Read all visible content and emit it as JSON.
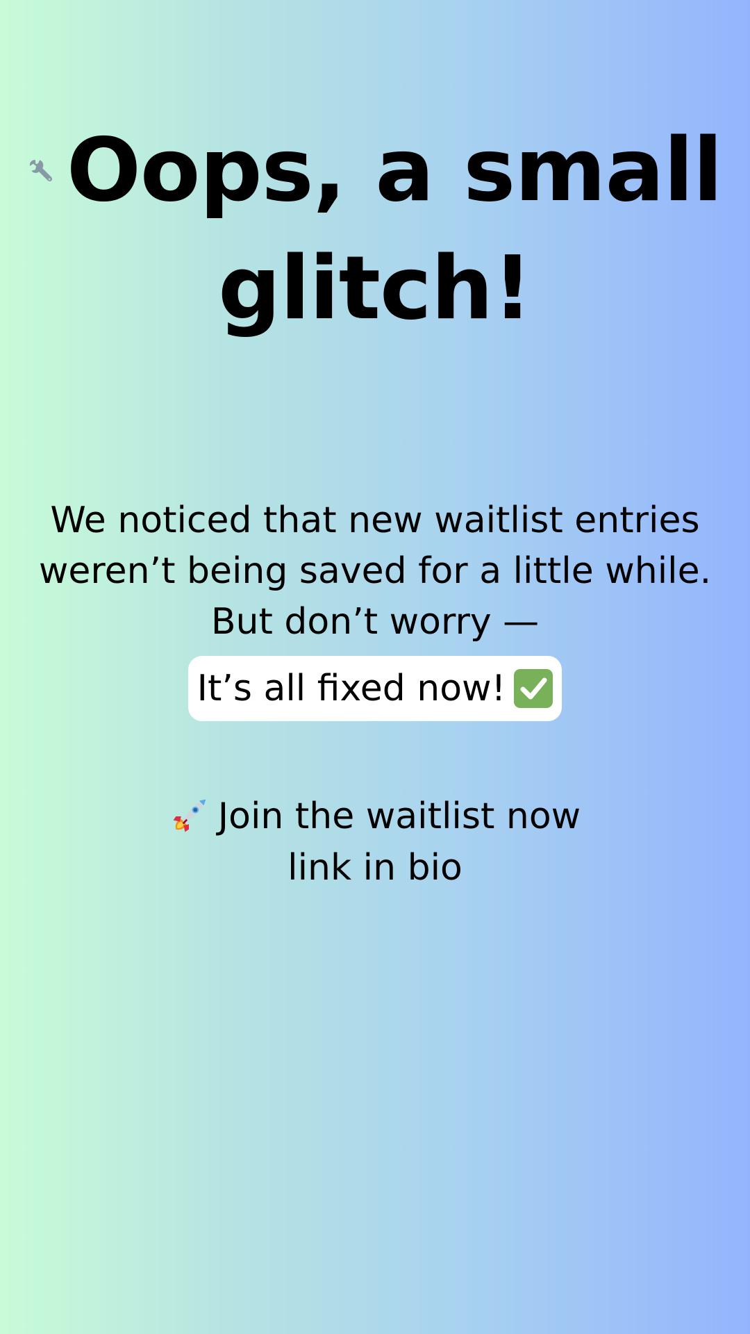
{
  "headline": {
    "line1": "Oops, a small",
    "line2": "glitch!",
    "icon": "wrench-icon"
  },
  "message": {
    "line1": "We noticed that new waitlist entries",
    "line2": "weren’t being saved for a little while.",
    "line3": "But don’t worry —"
  },
  "highlight": {
    "text": "It’s all fixed now!",
    "icon": "checkmark-icon"
  },
  "cta": {
    "line1": "Join the waitlist now",
    "line2": "link in bio",
    "icon": "rocket-icon"
  },
  "colors": {
    "gradient_left": "#c8fcd8",
    "gradient_right": "#93b5fd",
    "pill_background": "#ffffff",
    "check_green": "#78b159",
    "wrench_gray": "#8899a6"
  }
}
